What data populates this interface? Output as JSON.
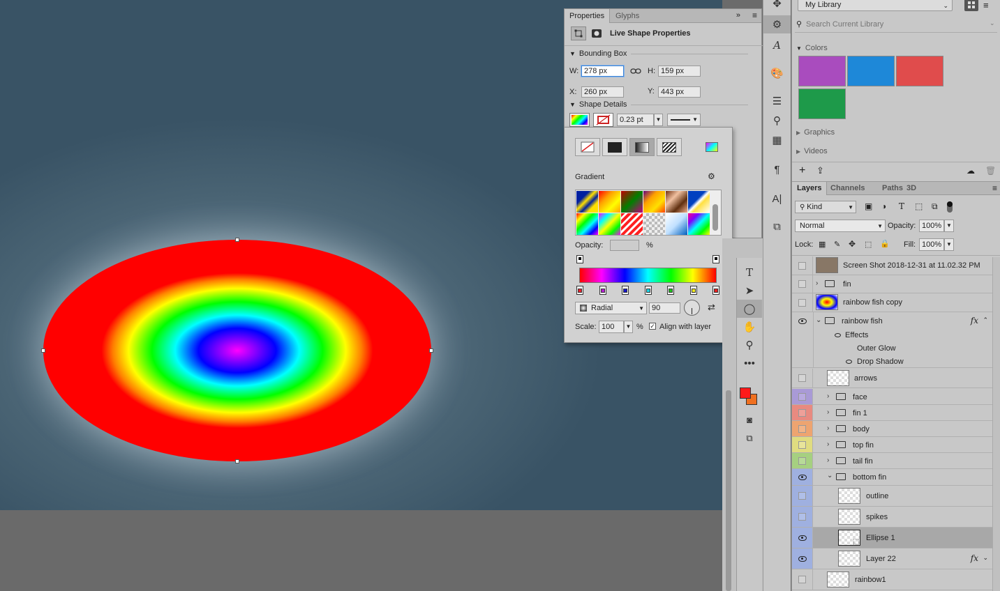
{
  "properties": {
    "tabs": [
      "Properties",
      "Glyphs"
    ],
    "header": "Live Shape Properties",
    "bounding_box": "Bounding Box",
    "w_label": "W:",
    "w_value": "278 px",
    "h_label": "H:",
    "h_value": "159 px",
    "x_label": "X:",
    "x_value": "260 px",
    "y_label": "Y:",
    "y_value": "443 px",
    "shape_details": "Shape Details",
    "stroke_width": "0.23 pt"
  },
  "gradient": {
    "label": "Gradient",
    "opacity_label": "Opacity:",
    "percent": "%",
    "style": "Radial",
    "angle": "90",
    "scale_label": "Scale:",
    "scale_value": "100",
    "align": "Align with layer",
    "stop_colors": [
      "#e8202a",
      "#b520d0",
      "#1818c8",
      "#20d0e0",
      "#20c020",
      "#f0e820",
      "#e82020"
    ]
  },
  "library": {
    "name": "My Library",
    "search_placeholder": "Search Current Library",
    "colors_label": "Colors",
    "colors": [
      "#a94cbe",
      "#1e88d8",
      "#e04c4c",
      "#1e9a4a"
    ],
    "graphics_label": "Graphics",
    "videos_label": "Videos"
  },
  "layers": {
    "tabs": [
      "Layers",
      "Channels",
      "Paths",
      "3D"
    ],
    "filter": "Kind",
    "blend": "Normal",
    "opacity_label": "Opacity:",
    "opacity": "100%",
    "lock_label": "Lock:",
    "fill_label": "Fill:",
    "fill": "100%",
    "effects_label": "Effects",
    "outer_glow": "Outer Glow",
    "drop_shadow": "Drop Shadow",
    "items": [
      "Screen Shot 2018-12-31 at 11.02.32 PM",
      "fin",
      "rainbow fish copy",
      "rainbow fish",
      "arrows",
      "face",
      "fin 1",
      "body",
      "top fin",
      "tail fin",
      "bottom fin",
      "outline",
      "spikes",
      "Ellipse 1",
      "Layer 22",
      "rainbow1"
    ]
  },
  "colors": {
    "foreground": "#ff1a1a",
    "background": "#f07020"
  }
}
